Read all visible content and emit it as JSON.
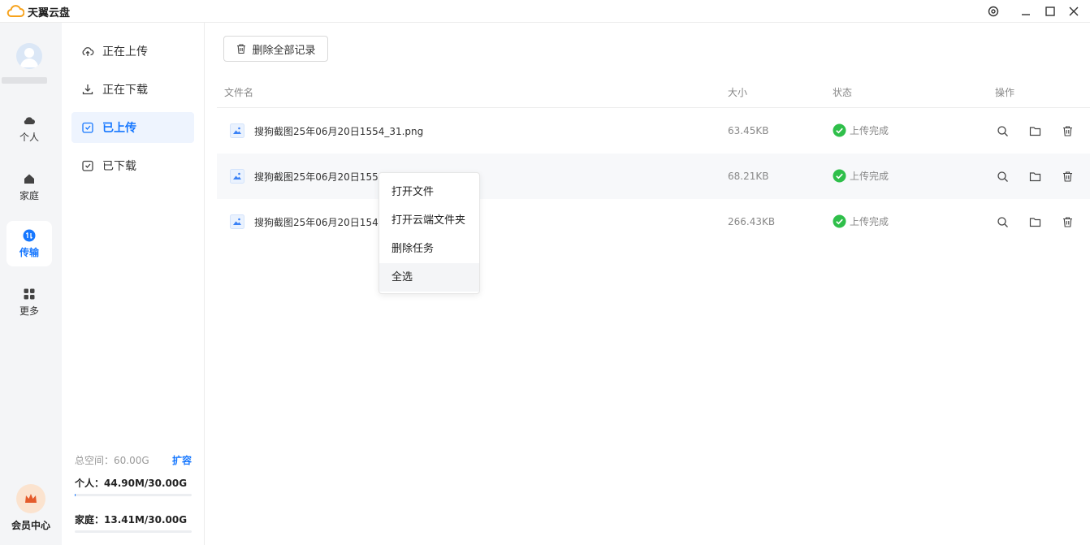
{
  "app": {
    "title": "天翼云盘"
  },
  "leftnav": {
    "items": [
      {
        "label": "个人",
        "icon": "cloud-icon"
      },
      {
        "label": "家庭",
        "icon": "home-icon"
      },
      {
        "label": "传输",
        "icon": "transfer-icon"
      },
      {
        "label": "更多",
        "icon": "grid-icon"
      }
    ],
    "vip_label": "会员中心"
  },
  "subnav": {
    "items": [
      {
        "label": "正在上传",
        "icon": "upload-cloud-icon"
      },
      {
        "label": "正在下载",
        "icon": "download-icon"
      },
      {
        "label": "已上传",
        "icon": "uploaded-check-icon"
      },
      {
        "label": "已下载",
        "icon": "downloaded-check-icon"
      }
    ],
    "active": "已上传"
  },
  "storage": {
    "total_label": "总空间：60.00G",
    "expand_label": "扩容",
    "personal": "个人：44.90M/30.00G",
    "family": "家庭：13.41M/30.00G",
    "personal_fraction": 0.0015,
    "family_fraction": 0.0004
  },
  "toolbar": {
    "delete_all_label": "删除全部记录"
  },
  "table": {
    "headers": {
      "name": "文件名",
      "size": "大小",
      "status": "状态",
      "actions": "操作"
    },
    "rows": [
      {
        "name": "搜狗截图25年06月20日1554_31.png",
        "size": "63.45KB",
        "status": "上传完成"
      },
      {
        "name": "搜狗截图25年06月20日1554",
        "size": "68.21KB",
        "status": "上传完成"
      },
      {
        "name": "搜狗截图25年06月20日1549",
        "size": "266.43KB",
        "status": "上传完成"
      }
    ]
  },
  "context_menu": {
    "items": [
      "打开文件",
      "打开云端文件夹",
      "删除任务",
      "全选"
    ]
  },
  "colors": {
    "accent": "#1677ff",
    "success": "#2fbf4a",
    "sidebar_bg": "#f4f5f7"
  }
}
